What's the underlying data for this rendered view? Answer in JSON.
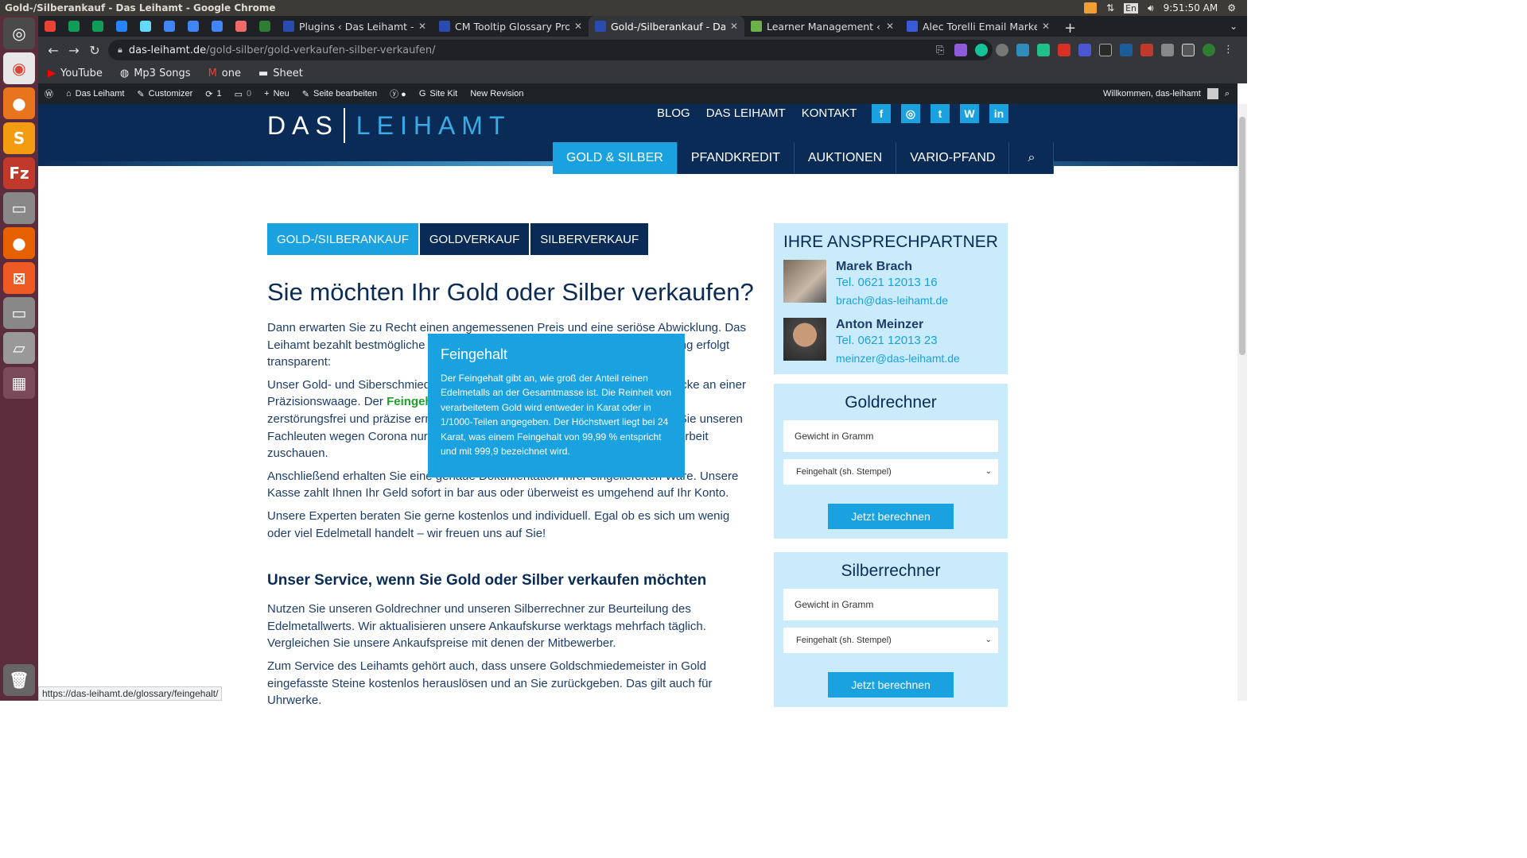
{
  "os": {
    "window_title": "Gold-/Silberankauf - Das Leihamt - Google Chrome",
    "time": "9:51:50 AM",
    "lang": "En"
  },
  "tabs": [
    {
      "title": "Plugins ‹ Das Leihamt — W",
      "color": "#2a4bb0"
    },
    {
      "title": "CM Tooltip Glossary Pro",
      "color": "#2a4bb0"
    },
    {
      "title": "Gold-/Silberankauf - Das L",
      "color": "#2a4bb0"
    },
    {
      "title": "Learner Management ‹ Co",
      "color": "#6bb04a"
    },
    {
      "title": "Alec Torelli Email Marketi",
      "color": "#3a5bd9"
    }
  ],
  "address": {
    "host": "das-leihamt.de",
    "path": "/gold-silber/gold-verkaufen-silber-verkaufen/"
  },
  "bookmarks": [
    "YouTube",
    "Mp3 Songs",
    "one",
    "Sheet"
  ],
  "wp_admin": {
    "site": "Das Leihamt",
    "customizer": "Customizer",
    "updates": "1",
    "comments": "0",
    "new": "Neu",
    "edit": "Seite bearbeiten",
    "sitekit": "Site Kit",
    "revision": "New Revision",
    "welcome": "Willkommen, das-leihamt"
  },
  "site": {
    "logo_left": "DAS",
    "logo_right": "LEIHAMT",
    "top_links": [
      "BLOG",
      "DAS LEIHAMT",
      "KONTAKT"
    ],
    "social": [
      "f",
      "◎",
      "t",
      "W",
      "in"
    ],
    "main_nav": [
      "GOLD & SILBER",
      "PFANDKREDIT",
      "AUKTIONEN",
      "VARIO-PFAND"
    ],
    "sub_tabs": [
      "GOLD-/SILBERANKAUF",
      "GOLDVERKAUF",
      "SILBERVERKAUF"
    ]
  },
  "article": {
    "title": "Sie möchten Ihr Gold oder Silber verkaufen?",
    "p1": "Dann erwarten Sie zu Recht einen angemessenen Preis und eine seriöse Abwicklung. Das Leihamt bezahlt bestmögliche Beträge für Ihr Edelmetall. Die Ankaufsabwicklung erfolgt transparent:",
    "p2_a": "Unser Gold- und Siberschmiedemeister prüft das Edelmetall Ihrer Schmuckstücke an einer Präzisionswaage. Der ",
    "p2_link": "Feingehalt",
    "p2_b": " wird mit einer Präzisionswaage und Schall zerstörungsfrei und präzise ermittelt. Während der gesamten Prüfung können Sie unseren Fachleuten wegen Corona nur durch eine Glasscheibe, aber jederzeit bei der Arbeit zuschauen.",
    "p3": "Anschließend erhalten Sie eine genaue Dokumentation Ihrer eingelieferten Ware. Unsere Kasse zahlt Ihnen Ihr Geld sofort in bar aus oder überweist es umgehend auf Ihr Konto.",
    "p4": "Unsere Experten beraten Sie gerne kostenlos und individuell. Egal ob es sich um wenig oder viel Edelmetall handelt – wir freuen uns auf Sie!",
    "h2": "Unser Service, wenn Sie Gold oder Silber verkaufen möchten",
    "p5": "Nutzen Sie unseren Goldrechner und unseren Silberrechner zur Beurteilung des Edelmetallwerts. Wir aktualisieren unsere Ankaufskurse werktags mehrfach täglich. Vergleichen Sie unsere Ankaufspreise mit denen der Mitbewerber.",
    "p6": "Zum Service des Leihamts gehört auch, dass unsere Goldschmiedemeister in Gold eingefasste Steine kostenlos herauslösen und an Sie zurückgeben. Das gilt auch für Uhrwerke."
  },
  "tooltip": {
    "title": "Feingehalt",
    "body": "Der Feingehalt gibt an, wie groß der Anteil reinen Edelmetalls an der Gesamtmasse ist. Die Reinheit von verarbeitetem Gold wird entweder in Karat oder in 1/1000-Teilen angegeben. Der Höchstwert liegt bei 24 Karat, was einem Feingehalt von 99,99 % entspricht und mit 999,9 bezeichnet wird."
  },
  "sidebar": {
    "contacts_title": "IHRE ANSPRECHPARTNER",
    "contacts": [
      {
        "name": "Marek Brach",
        "tel": "Tel. 0621 12013 16",
        "mail": "brach@das-leihamt.de"
      },
      {
        "name": "Anton Meinzer",
        "tel": "Tel. 0621 12013 23",
        "mail": "meinzer@das-leihamt.de"
      }
    ],
    "gold": {
      "title": "Goldrechner",
      "input_placeholder": "Gewicht in Gramm",
      "select": "Feingehalt (sh. Stempel)",
      "button": "Jetzt berechnen"
    },
    "silver": {
      "title": "Silberrechner",
      "input_placeholder": "Gewicht in Gramm",
      "select": "Feingehalt (sh. Stempel)",
      "button": "Jetzt berechnen"
    }
  },
  "status_url": "https://das-leihamt.de/glossary/feingehalt/"
}
